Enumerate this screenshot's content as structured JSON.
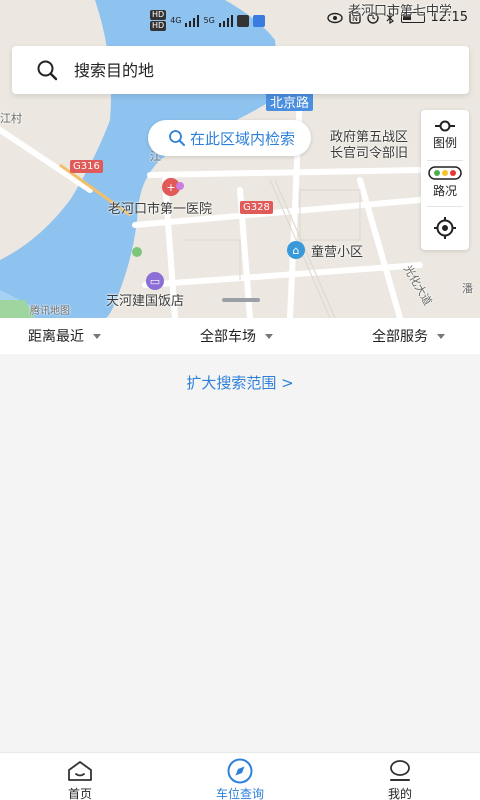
{
  "status_bar": {
    "network_badges": [
      "HD",
      "HD"
    ],
    "signal_a": "4G",
    "signal_b": "5G",
    "time": "12:15"
  },
  "map": {
    "labels": {
      "school": "老河口市第七中学",
      "jiang_cun": "江村",
      "beijing_road": "北京路",
      "gov_1": "政府第五战区",
      "gov_2": "长官司令部旧",
      "g316": "G316",
      "g328": "G328",
      "hospital": "老河口市第一医院",
      "community": "童营小区",
      "hotel": "天河建国饭店",
      "guanghua_road": "光化大道",
      "pan": "潘",
      "river_mark": "江",
      "logo": "腾讯地图"
    },
    "colors": {
      "water": "#8ec3f0",
      "land": "#ece8e1",
      "road": "#ffffff",
      "accent": "#2f80d8",
      "highway": "#e05a5a"
    }
  },
  "search": {
    "placeholder": "搜索目的地",
    "icon": "search-icon"
  },
  "area_search": {
    "label": "在此区域内检索"
  },
  "map_controls": {
    "legend_label": "图例",
    "traffic_label": "路况",
    "locate_icon": "locate-icon"
  },
  "filters": {
    "distance": "距离最近",
    "parking": "全部车场",
    "service": "全部服务"
  },
  "expand_search": "扩大搜索范围 >",
  "bottom_nav": {
    "tabs": [
      {
        "label": "首页",
        "icon": "home-icon",
        "active": false
      },
      {
        "label": "车位查询",
        "icon": "compass-icon",
        "active": true
      },
      {
        "label": "我的",
        "icon": "user-icon",
        "active": false
      }
    ]
  }
}
